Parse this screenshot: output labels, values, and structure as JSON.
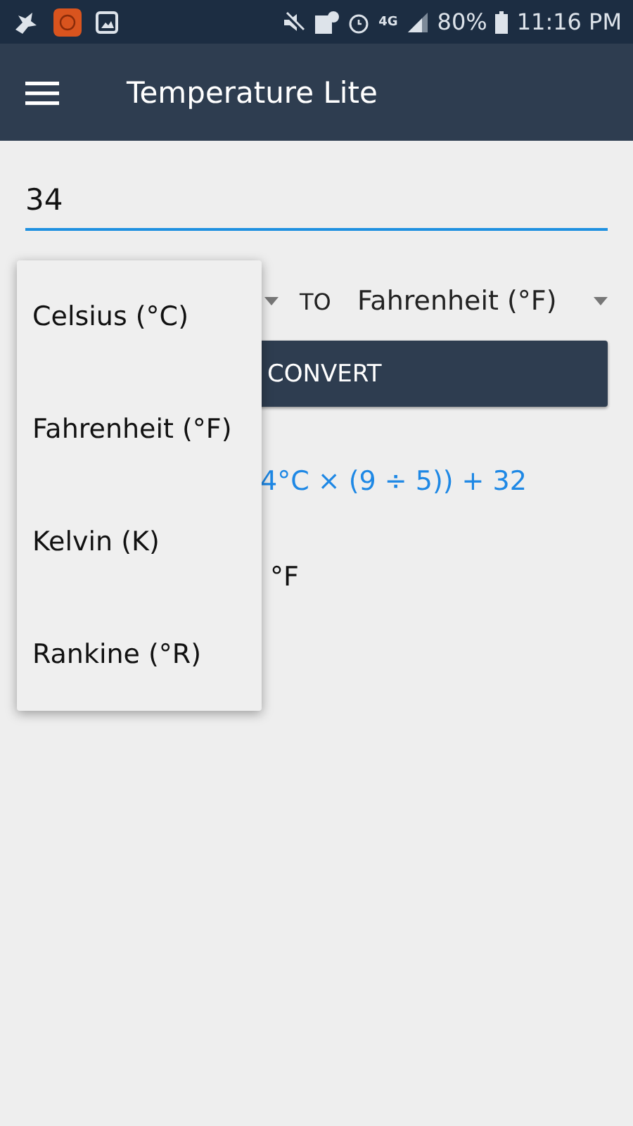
{
  "status_bar": {
    "network": "4G",
    "battery": "80%",
    "time": "11:16 PM"
  },
  "app_bar": {
    "title": "Temperature Lite"
  },
  "input": {
    "value": "34"
  },
  "to_label": "TO",
  "to_unit": "Fahrenheit (°F)",
  "convert_button": "CONVERT",
  "formula": "4°C × (9 ÷ 5)) + 32",
  "result": "°F",
  "menu": [
    {
      "label": "Celsius (°C)",
      "selected": false
    },
    {
      "label": "Fahrenheit (°F)",
      "selected": false
    },
    {
      "label": "Kelvin (K)",
      "selected": false
    },
    {
      "label": "Rankine (°R)",
      "selected": false
    }
  ]
}
